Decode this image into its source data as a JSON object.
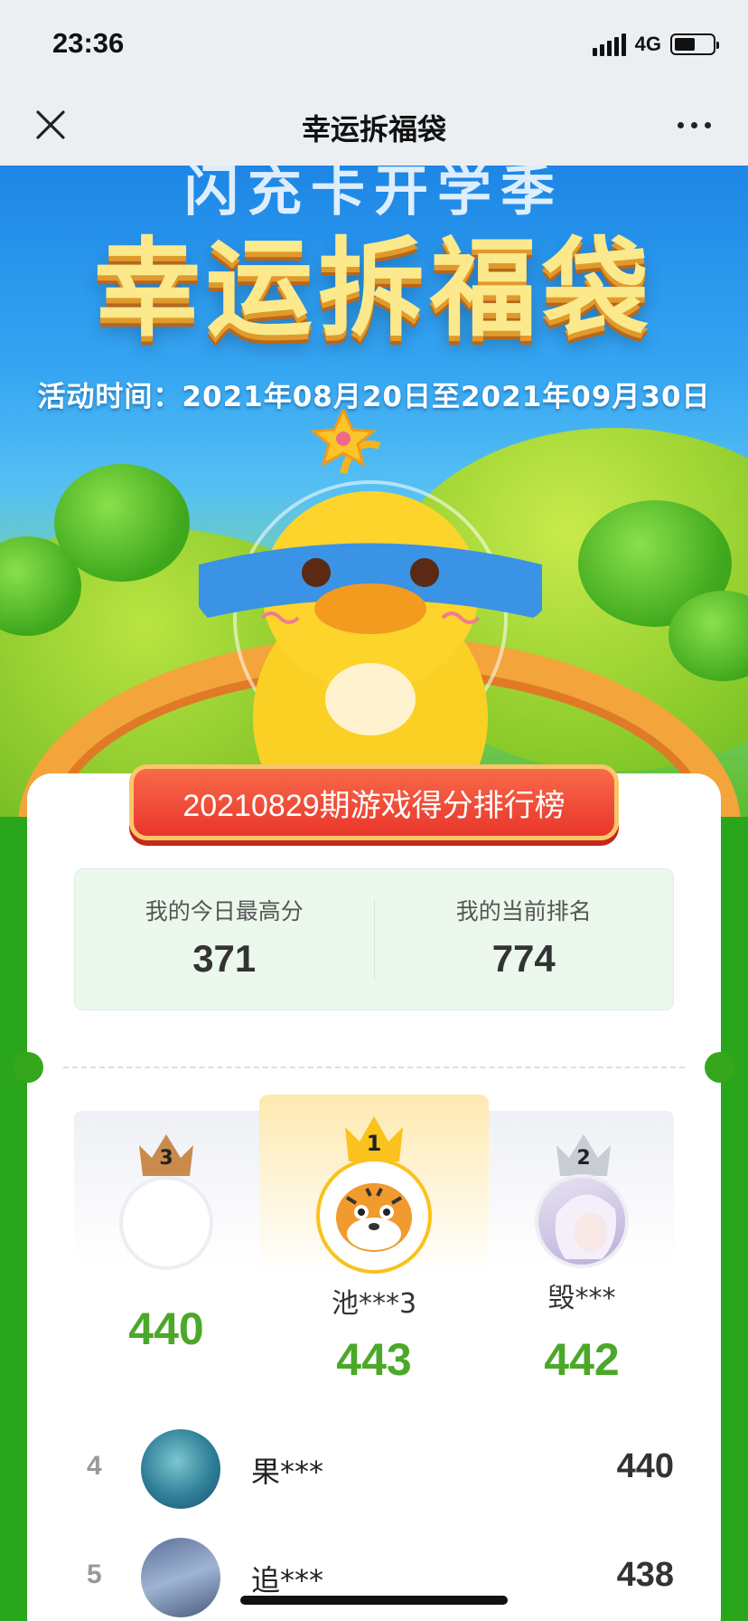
{
  "status_bar": {
    "time": "23:36",
    "network": "4G",
    "battery_level": 0.55
  },
  "nav": {
    "title": "幸运拆福袋",
    "close_icon": "close-icon",
    "more_icon": "more-dots-icon"
  },
  "hero": {
    "subtitle_top": "闪充卡开学季",
    "title": "幸运拆福袋",
    "date": "活动时间：2021年08月20日至2021年09月30日"
  },
  "leaderboard": {
    "ribbon_title": "20210829期游戏得分排行榜",
    "my_best_label": "我的今日最高分",
    "my_best_value": "371",
    "my_rank_label": "我的当前排名",
    "my_rank_value": "774",
    "podium": {
      "first": {
        "rank": "1",
        "name": "池***3",
        "score": "443"
      },
      "second": {
        "rank": "2",
        "name": "毁***",
        "score": "442"
      },
      "third": {
        "rank": "3",
        "name": "",
        "score": "440"
      }
    },
    "rows": [
      {
        "rank": "4",
        "name": "果***",
        "score": "440"
      },
      {
        "rank": "5",
        "name": "追***",
        "score": "438"
      }
    ]
  },
  "colors": {
    "accent_green": "#4ba829",
    "ribbon_red": "#e9362b",
    "page_green": "#2aa61c"
  }
}
